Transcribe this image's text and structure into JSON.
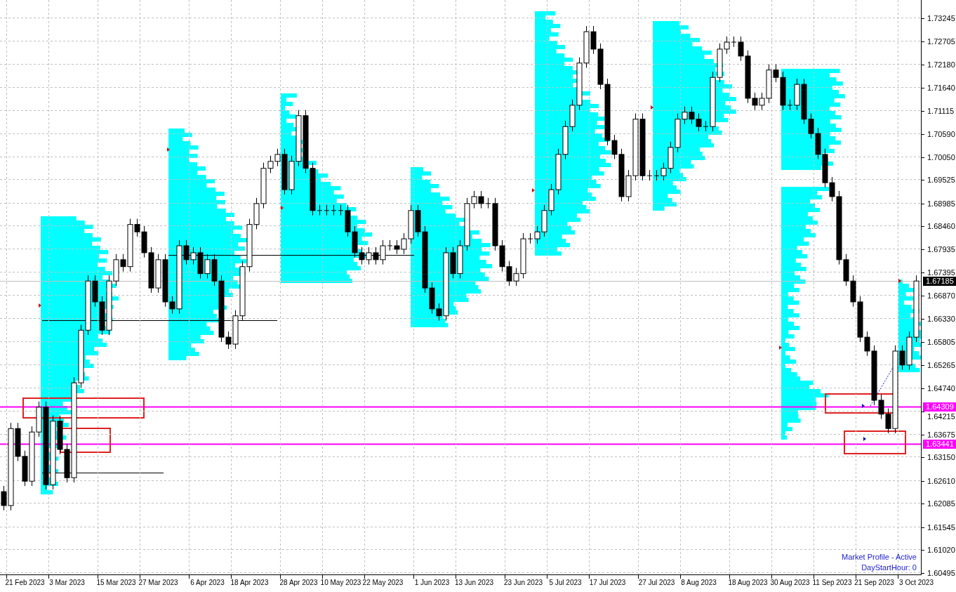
{
  "indicator": {
    "name": "Market Profile - Active",
    "setting": "DayStartHour: 0"
  },
  "price_badges": [
    {
      "label": "1.67185",
      "kind": "current",
      "color": "#000000"
    },
    {
      "label": "1.64309",
      "kind": "level",
      "color": "#ff00ff"
    },
    {
      "label": "1.63441",
      "kind": "level",
      "color": "#ff00ff"
    }
  ],
  "chart_data": {
    "type": "candlestick",
    "ylim": [
      1.60495,
      1.73245
    ],
    "grid": true,
    "yticks": [
      {
        "value": 1.73245,
        "label": "1.73245"
      },
      {
        "value": 1.72705,
        "label": "1.72705"
      },
      {
        "value": 1.7218,
        "label": "1.72180"
      },
      {
        "value": 1.7164,
        "label": "1.71640"
      },
      {
        "value": 1.71115,
        "label": "1.71115"
      },
      {
        "value": 1.7059,
        "label": "1.70590"
      },
      {
        "value": 1.7005,
        "label": "1.70050"
      },
      {
        "value": 1.69525,
        "label": "1.69525"
      },
      {
        "value": 1.68985,
        "label": "1.68985"
      },
      {
        "value": 1.6846,
        "label": "1.68460"
      },
      {
        "value": 1.67935,
        "label": "1.67935"
      },
      {
        "value": 1.67395,
        "label": "1.67395"
      },
      {
        "value": 1.6687,
        "label": "1.66870"
      },
      {
        "value": 1.6633,
        "label": "1.66330"
      },
      {
        "value": 1.65805,
        "label": "1.65805"
      },
      {
        "value": 1.65265,
        "label": "1.65265"
      },
      {
        "value": 1.6474,
        "label": "1.64740"
      },
      {
        "value": 1.64215,
        "label": "1.64215"
      },
      {
        "value": 1.63675,
        "label": "1.63675"
      },
      {
        "value": 1.6315,
        "label": "1.63150"
      },
      {
        "value": 1.6261,
        "label": "1.62610"
      },
      {
        "value": 1.62085,
        "label": "1.62085"
      },
      {
        "value": 1.61545,
        "label": "1.61545"
      },
      {
        "value": 1.6102,
        "label": "1.61020"
      },
      {
        "value": 1.60495,
        "label": "1.60495"
      }
    ],
    "categories": [
      null,
      null,
      null,
      "21 Feb 2023",
      null,
      null,
      null,
      null,
      null,
      "3 Mar 2023",
      null,
      null,
      null,
      null,
      null,
      null,
      "15 Mar 2023",
      null,
      null,
      null,
      null,
      null,
      "27 Mar 2023",
      null,
      null,
      null,
      null,
      null,
      null,
      "6 Apr 2023",
      null,
      null,
      null,
      null,
      null,
      "18 Apr 2023",
      null,
      null,
      null,
      null,
      null,
      null,
      "28 Apr 2023",
      null,
      null,
      null,
      null,
      null,
      "10 May 2023",
      null,
      null,
      null,
      null,
      null,
      "22 May 2023",
      null,
      null,
      null,
      null,
      null,
      null,
      "1 Jun 2023",
      null,
      null,
      null,
      null,
      null,
      "13 Jun 2023",
      null,
      null,
      null,
      null,
      null,
      null,
      "23 Jun 2023",
      null,
      null,
      null,
      null,
      null,
      "5 Jul 2023",
      null,
      null,
      null,
      null,
      null,
      "17 Jul 2023",
      null,
      null,
      null,
      null,
      null,
      null,
      "27 Jul 2023",
      null,
      null,
      null,
      null,
      null,
      "8 Aug 2023",
      null,
      null,
      null,
      null,
      null,
      null,
      "18 Aug 2023",
      null,
      null,
      null,
      null,
      null,
      "30 Aug 2023",
      null,
      null,
      null,
      null,
      null,
      "11 Sep 2023",
      null,
      null,
      null,
      null,
      null,
      "21 Sep 2023",
      null,
      null,
      null,
      null,
      null,
      "3 Oct 2023"
    ],
    "ohlc": [
      [
        1.6235,
        1.6248,
        1.6192,
        1.6203
      ],
      [
        1.6203,
        1.6393,
        1.6192,
        1.638
      ],
      [
        1.638,
        1.6393,
        1.6305,
        1.6316
      ],
      [
        1.6316,
        1.6329,
        1.6248,
        1.6259
      ],
      [
        1.6259,
        1.6385,
        1.6248,
        1.6372
      ],
      [
        1.6372,
        1.6442,
        1.6361,
        1.6429
      ],
      [
        1.6429,
        1.6442,
        1.624,
        1.6251
      ],
      [
        1.6251,
        1.641,
        1.624,
        1.6397
      ],
      [
        1.6397,
        1.641,
        1.6321,
        1.6332
      ],
      [
        1.6332,
        1.6345,
        1.6256,
        1.6267
      ],
      [
        1.6267,
        1.6498,
        1.6256,
        1.6485
      ],
      [
        1.6485,
        1.6619,
        1.6474,
        1.6606
      ],
      [
        1.6606,
        1.6732,
        1.6595,
        1.6719
      ],
      [
        1.6719,
        1.6732,
        1.666,
        1.6671
      ],
      [
        1.6671,
        1.6684,
        1.6595,
        1.6606
      ],
      [
        1.6606,
        1.6732,
        1.6595,
        1.6719
      ],
      [
        1.6719,
        1.6781,
        1.6708,
        1.6768
      ],
      [
        1.6768,
        1.6781,
        1.6741,
        1.6752
      ],
      [
        1.6752,
        1.6862,
        1.6741,
        1.6849
      ],
      [
        1.6849,
        1.6862,
        1.6821,
        1.6832
      ],
      [
        1.6832,
        1.6845,
        1.6773,
        1.6784
      ],
      [
        1.6784,
        1.6797,
        1.6692,
        1.6703
      ],
      [
        1.6703,
        1.6781,
        1.6692,
        1.6768
      ],
      [
        1.6768,
        1.6781,
        1.666,
        1.6671
      ],
      [
        1.6671,
        1.6684,
        1.6644,
        1.6655
      ],
      [
        1.6655,
        1.6813,
        1.6644,
        1.68
      ],
      [
        1.68,
        1.6813,
        1.6757,
        1.6768
      ],
      [
        1.6768,
        1.6797,
        1.6757,
        1.6784
      ],
      [
        1.6784,
        1.6797,
        1.6725,
        1.6736
      ],
      [
        1.6736,
        1.6781,
        1.6725,
        1.6768
      ],
      [
        1.6768,
        1.6781,
        1.6708,
        1.6719
      ],
      [
        1.6719,
        1.6732,
        1.6579,
        1.659
      ],
      [
        1.659,
        1.6603,
        1.6563,
        1.6574
      ],
      [
        1.6574,
        1.6652,
        1.6563,
        1.6639
      ],
      [
        1.6639,
        1.6765,
        1.6628,
        1.6752
      ],
      [
        1.6752,
        1.6862,
        1.6741,
        1.6849
      ],
      [
        1.6849,
        1.691,
        1.6838,
        1.6897
      ],
      [
        1.6897,
        1.6991,
        1.6886,
        1.6978
      ],
      [
        1.6978,
        1.7007,
        1.6967,
        1.6994
      ],
      [
        1.6994,
        1.7023,
        1.6983,
        1.701
      ],
      [
        1.701,
        1.7023,
        1.6918,
        1.6929
      ],
      [
        1.6929,
        1.7007,
        1.6918,
        1.6994
      ],
      [
        1.6994,
        1.7112,
        1.6983,
        1.7099
      ],
      [
        1.7099,
        1.7112,
        1.6967,
        1.6978
      ],
      [
        1.6978,
        1.6991,
        1.687,
        1.6881
      ],
      [
        1.6881,
        1.6894,
        1.687,
        1.6881
      ],
      [
        1.6881,
        1.6894,
        1.687,
        1.6881
      ],
      [
        1.6881,
        1.6894,
        1.687,
        1.6881
      ],
      [
        1.6881,
        1.6894,
        1.687,
        1.6881
      ],
      [
        1.6881,
        1.6894,
        1.6821,
        1.6832
      ],
      [
        1.6832,
        1.6845,
        1.6773,
        1.6784
      ],
      [
        1.6784,
        1.6797,
        1.6757,
        1.6768
      ],
      [
        1.6768,
        1.6797,
        1.6757,
        1.6784
      ],
      [
        1.6784,
        1.6797,
        1.6757,
        1.6768
      ],
      [
        1.6768,
        1.6813,
        1.6757,
        1.68
      ],
      [
        1.68,
        1.6813,
        1.6789,
        1.68
      ],
      [
        1.68,
        1.6813,
        1.6781,
        1.6792
      ],
      [
        1.6792,
        1.6829,
        1.6781,
        1.6816
      ],
      [
        1.6816,
        1.6894,
        1.6805,
        1.6881
      ],
      [
        1.6881,
        1.6894,
        1.6821,
        1.6832
      ],
      [
        1.6832,
        1.6845,
        1.6692,
        1.6703
      ],
      [
        1.6703,
        1.6716,
        1.6644,
        1.6655
      ],
      [
        1.6655,
        1.6668,
        1.6628,
        1.6639
      ],
      [
        1.6639,
        1.6797,
        1.6628,
        1.6784
      ],
      [
        1.6784,
        1.6797,
        1.6725,
        1.6736
      ],
      [
        1.6736,
        1.6813,
        1.6725,
        1.68
      ],
      [
        1.68,
        1.691,
        1.6789,
        1.6897
      ],
      [
        1.6897,
        1.6926,
        1.6886,
        1.6913
      ],
      [
        1.6913,
        1.6926,
        1.6886,
        1.6897
      ],
      [
        1.6897,
        1.691,
        1.6886,
        1.6897
      ],
      [
        1.6897,
        1.691,
        1.6789,
        1.68
      ],
      [
        1.68,
        1.6813,
        1.6741,
        1.6752
      ],
      [
        1.6752,
        1.6765,
        1.6708,
        1.6719
      ],
      [
        1.6719,
        1.6749,
        1.6708,
        1.6736
      ],
      [
        1.6736,
        1.6829,
        1.6725,
        1.6816
      ],
      [
        1.6816,
        1.6829,
        1.6805,
        1.6816
      ],
      [
        1.6816,
        1.6845,
        1.6805,
        1.6832
      ],
      [
        1.6832,
        1.6894,
        1.6821,
        1.6881
      ],
      [
        1.6881,
        1.6942,
        1.687,
        1.6929
      ],
      [
        1.6929,
        1.7023,
        1.6918,
        1.701
      ],
      [
        1.701,
        1.7087,
        1.6999,
        1.7074
      ],
      [
        1.7074,
        1.7136,
        1.7063,
        1.7123
      ],
      [
        1.7123,
        1.7233,
        1.7112,
        1.722
      ],
      [
        1.722,
        1.7305,
        1.7209,
        1.7292
      ],
      [
        1.7292,
        1.7305,
        1.7241,
        1.7252
      ],
      [
        1.7252,
        1.7265,
        1.716,
        1.7171
      ],
      [
        1.7171,
        1.7184,
        1.7031,
        1.7042
      ],
      [
        1.7042,
        1.7055,
        1.6999,
        1.701
      ],
      [
        1.701,
        1.7023,
        1.6902,
        1.6913
      ],
      [
        1.6913,
        1.6974,
        1.6902,
        1.6961
      ],
      [
        1.6961,
        1.7104,
        1.695,
        1.7091
      ],
      [
        1.7091,
        1.7104,
        1.695,
        1.6961
      ],
      [
        1.6961,
        1.6974,
        1.695,
        1.6961
      ],
      [
        1.6961,
        1.6974,
        1.695,
        1.6961
      ],
      [
        1.6961,
        1.6991,
        1.695,
        1.6978
      ],
      [
        1.6978,
        1.7039,
        1.6967,
        1.7026
      ],
      [
        1.7026,
        1.7104,
        1.7015,
        1.7091
      ],
      [
        1.7091,
        1.712,
        1.708,
        1.7107
      ],
      [
        1.7107,
        1.712,
        1.708,
        1.7091
      ],
      [
        1.7091,
        1.7104,
        1.7063,
        1.7074
      ],
      [
        1.7074,
        1.7087,
        1.7063,
        1.7074
      ],
      [
        1.7074,
        1.72,
        1.7063,
        1.7187
      ],
      [
        1.7187,
        1.7265,
        1.7176,
        1.7252
      ],
      [
        1.7252,
        1.7281,
        1.7241,
        1.7268
      ],
      [
        1.7268,
        1.7281,
        1.7257,
        1.7268
      ],
      [
        1.7268,
        1.7281,
        1.7225,
        1.7236
      ],
      [
        1.7236,
        1.7249,
        1.7128,
        1.7139
      ],
      [
        1.7139,
        1.7152,
        1.7112,
        1.7123
      ],
      [
        1.7123,
        1.7152,
        1.7112,
        1.7139
      ],
      [
        1.7139,
        1.7217,
        1.7128,
        1.7204
      ],
      [
        1.7204,
        1.7217,
        1.7176,
        1.7187
      ],
      [
        1.7187,
        1.72,
        1.7112,
        1.7123
      ],
      [
        1.7123,
        1.7136,
        1.7112,
        1.7123
      ],
      [
        1.7123,
        1.7184,
        1.7112,
        1.7171
      ],
      [
        1.7171,
        1.7184,
        1.708,
        1.7091
      ],
      [
        1.7091,
        1.7104,
        1.7047,
        1.7058
      ],
      [
        1.7058,
        1.7071,
        1.6999,
        1.701
      ],
      [
        1.701,
        1.7023,
        1.6934,
        1.6945
      ],
      [
        1.6945,
        1.6958,
        1.6902,
        1.6913
      ],
      [
        1.6913,
        1.6926,
        1.6757,
        1.6768
      ],
      [
        1.6768,
        1.6781,
        1.6708,
        1.6719
      ],
      [
        1.6719,
        1.6732,
        1.666,
        1.6671
      ],
      [
        1.6671,
        1.6684,
        1.6579,
        1.659
      ],
      [
        1.659,
        1.6603,
        1.6547,
        1.6558
      ],
      [
        1.6558,
        1.6571,
        1.6434,
        1.6445
      ],
      [
        1.6445,
        1.6458,
        1.6402,
        1.6413
      ],
      [
        1.6413,
        1.6426,
        1.6369,
        1.638
      ],
      [
        1.638,
        1.6571,
        1.6369,
        1.6558
      ],
      [
        1.6558,
        1.6571,
        1.6515,
        1.6526
      ],
      [
        1.6526,
        1.6603,
        1.6515,
        1.659
      ],
      [
        1.659,
        1.6732,
        1.6579,
        1.6719
      ]
    ]
  }
}
